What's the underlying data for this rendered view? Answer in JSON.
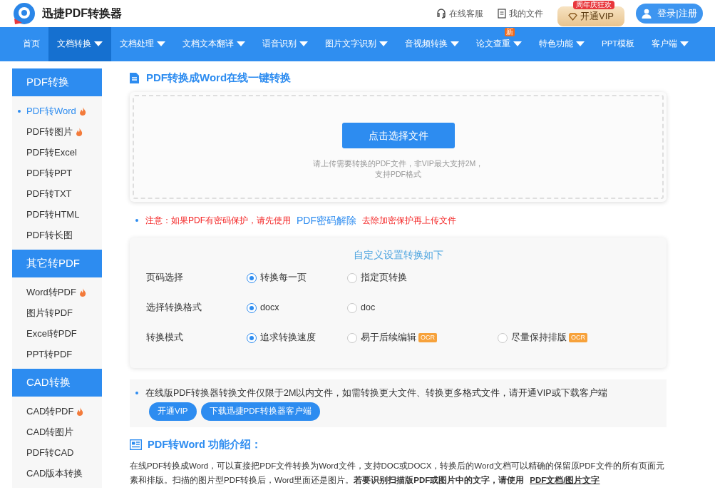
{
  "header": {
    "brand": "迅捷PDF转换器",
    "links": [
      {
        "kind": "headset",
        "label": "在线客服"
      },
      {
        "kind": "file",
        "label": "我的文件"
      }
    ],
    "vip_button": {
      "label": "开通VIP",
      "badge": "周年庆狂欢"
    },
    "login_button": {
      "label": "登录|注册"
    }
  },
  "nav": [
    {
      "label": "首页",
      "dropdown": false,
      "selected": false
    },
    {
      "label": "文档转换",
      "dropdown": true,
      "selected": true
    },
    {
      "label": "文档处理",
      "dropdown": true,
      "selected": false
    },
    {
      "label": "文档文本翻译",
      "dropdown": true,
      "selected": false
    },
    {
      "label": "语音识别",
      "dropdown": true,
      "selected": false
    },
    {
      "label": "图片文字识别",
      "dropdown": true,
      "selected": false
    },
    {
      "label": "音视频转换",
      "dropdown": true,
      "selected": false
    },
    {
      "label": "论文查重",
      "dropdown": true,
      "selected": false,
      "badge": "新"
    },
    {
      "label": "特色功能",
      "dropdown": true,
      "selected": false
    },
    {
      "label": "PPT模板",
      "dropdown": false,
      "selected": false
    },
    {
      "label": "客户端",
      "dropdown": true,
      "selected": false
    }
  ],
  "sidebar": [
    {
      "title": "PDF转换",
      "items": [
        {
          "label": "PDF转Word",
          "hot": true,
          "selected": true
        },
        {
          "label": "PDF转图片",
          "hot": true,
          "selected": false
        },
        {
          "label": "PDF转Excel",
          "hot": false,
          "selected": false
        },
        {
          "label": "PDF转PPT",
          "hot": false,
          "selected": false
        },
        {
          "label": "PDF转TXT",
          "hot": false,
          "selected": false
        },
        {
          "label": "PDF转HTML",
          "hot": false,
          "selected": false
        },
        {
          "label": "PDF转长图",
          "hot": false,
          "selected": false
        }
      ]
    },
    {
      "title": "其它转PDF",
      "items": [
        {
          "label": "Word转PDF",
          "hot": true,
          "selected": false
        },
        {
          "label": "图片转PDF",
          "hot": false,
          "selected": false
        },
        {
          "label": "Excel转PDF",
          "hot": false,
          "selected": false
        },
        {
          "label": "PPT转PDF",
          "hot": false,
          "selected": false
        }
      ]
    },
    {
      "title": "CAD转换",
      "items": [
        {
          "label": "CAD转PDF",
          "hot": true,
          "selected": false
        },
        {
          "label": "CAD转图片",
          "hot": false,
          "selected": false
        },
        {
          "label": "PDF转CAD",
          "hot": false,
          "selected": false
        },
        {
          "label": "CAD版本转换",
          "hot": false,
          "selected": false
        }
      ]
    }
  ],
  "main": {
    "title": "PDF转换成Word在线一键转换",
    "upload": {
      "button": "点击选择文件",
      "hint": [
        "请上传需要转换的PDF文件，非VIP最大支持2M，",
        "支持PDF格式"
      ]
    },
    "notice": {
      "before": "注意：如果PDF有密码保护，请先使用",
      "link": "PDF密码解除",
      "after": "去除加密保护再上传文件"
    },
    "settings": {
      "title": "自定义设置转换如下",
      "rows": [
        {
          "label": "页码选择",
          "options": [
            {
              "label": "转换每一页",
              "selected": true
            },
            {
              "label": "指定页转换",
              "selected": false
            }
          ]
        },
        {
          "label": "选择转换格式",
          "options": [
            {
              "label": "docx",
              "selected": true
            },
            {
              "label": "doc",
              "selected": false
            }
          ]
        },
        {
          "label": "转换模式",
          "options": [
            {
              "label": "追求转换速度",
              "selected": true
            },
            {
              "label": "易于后续编辑",
              "selected": false,
              "tag": "OCR"
            },
            {
              "label": "尽量保持排版",
              "selected": false,
              "tag": "OCR"
            }
          ]
        }
      ]
    },
    "limit": {
      "text": "在线版PDF转换器转换文件仅限于2M以内文件，如需转换更大文件、转换更多格式文件，请开通VIP或下载客户端",
      "buttons": [
        "开通VIP",
        "下载迅捷PDF转换器客户端"
      ]
    },
    "intro": {
      "title": "PDF转Word 功能介绍：",
      "text": "在线PDF转换成Word，可以直接把PDF文件转换为Word文件，支持DOC或DOCX，转换后的Word文档可以精确的保留原PDF文件的所有页面元素和排版。扫描的图片型PDF转换后，Word里面还是图片。**若要识别扫描版PDF或图片中的文字，请使用**",
      "link": "PDF文档/图片文字"
    }
  }
}
